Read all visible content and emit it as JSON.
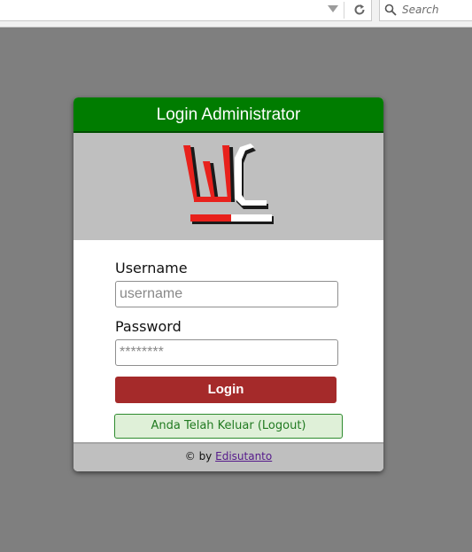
{
  "browser": {
    "search_placeholder": "Search"
  },
  "login": {
    "title": "Login Administrator",
    "username_label": "Username",
    "username_placeholder": "username",
    "password_label": "Password",
    "password_placeholder": "********",
    "login_button": "Login",
    "logout_notice": "Anda Telah Keluar (Logout)",
    "footer_prefix": "© by",
    "footer_link": "Edisutanto"
  },
  "colors": {
    "header_bg": "#007c00",
    "button_bg": "#a52a2a",
    "notice_bg": "#dff0d8",
    "page_bg": "#7f7f7f"
  }
}
